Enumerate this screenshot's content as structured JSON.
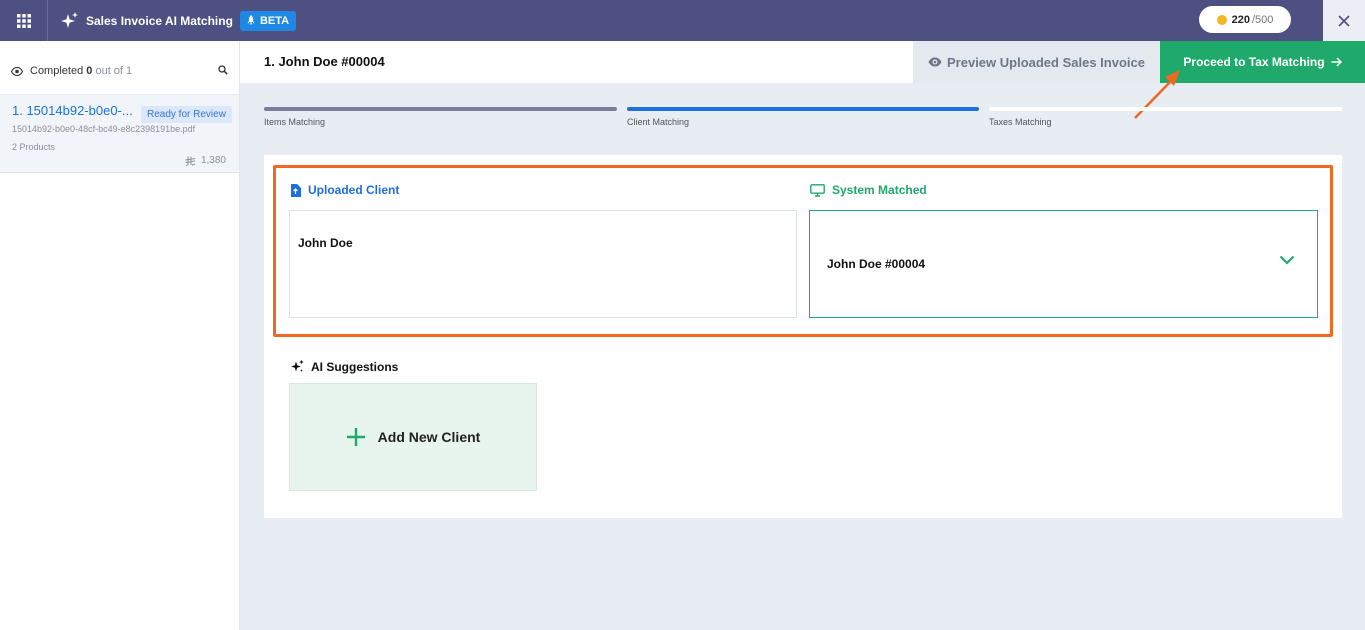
{
  "app": {
    "title": "Sales Invoice AI Matching",
    "beta": "BETA",
    "credits_used": "220",
    "credits_total": "/500"
  },
  "sidebar": {
    "completed_label": "Completed",
    "completed_count": "0",
    "out_of": "out of 1",
    "items": [
      {
        "title": "1. 15014b92-b0e0-...",
        "status": "Ready for Review",
        "file": "15014b92-b0e0-48cf-bc49-e8c2398191be.pdf",
        "products": "2 Products",
        "amount": "1,380"
      }
    ]
  },
  "header": {
    "title": "1. John Doe #00004",
    "preview_label": "Preview Uploaded Sales Invoice",
    "proceed_label": "Proceed to Tax Matching"
  },
  "steps": [
    {
      "label": "Items Matching",
      "state": "done",
      "color": "#7a7d9e"
    },
    {
      "label": "Client Matching",
      "state": "active",
      "color": "#1e6fd9"
    },
    {
      "label": "Taxes Matching",
      "state": "pending",
      "color": "#ffffff"
    }
  ],
  "matching": {
    "uploaded_label": "Uploaded Client",
    "uploaded_value": "John Doe",
    "system_label": "System Matched",
    "system_value": "John Doe #00004"
  },
  "ai": {
    "label": "AI Suggestions",
    "add_client_label": "Add New Client"
  },
  "colors": {
    "topbar": "#4d5080",
    "accent_blue": "#1e6fd9",
    "accent_green": "#1fa96b",
    "highlight": "#f26722"
  }
}
